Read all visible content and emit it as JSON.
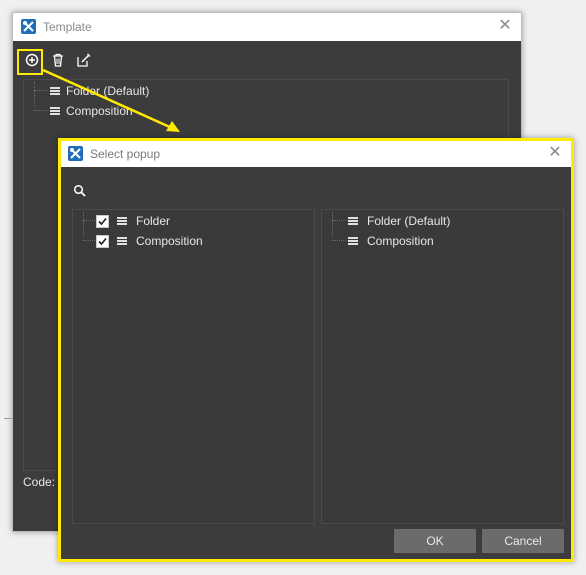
{
  "template_window": {
    "title": "Template",
    "close_glyph": "✕",
    "toolbar": {
      "add_icon": "add-circle-icon",
      "delete_icon": "trash-icon",
      "edit_icon": "edit-icon"
    },
    "tree": [
      "Folder (Default)",
      "Composition"
    ],
    "code_label": "Code:"
  },
  "select_popup": {
    "title": "Select popup",
    "close_glyph": "✕",
    "search_icon": "search-icon",
    "left_list": [
      {
        "label": "Folder",
        "checked": true
      },
      {
        "label": "Composition",
        "checked": true
      }
    ],
    "right_list": [
      "Folder (Default)",
      "Composition"
    ],
    "ok_label": "OK",
    "cancel_label": "Cancel"
  },
  "colors": {
    "highlight": "#ffea00",
    "window_bg": "#3c3c3c",
    "button_bg": "#6b6b6b"
  }
}
